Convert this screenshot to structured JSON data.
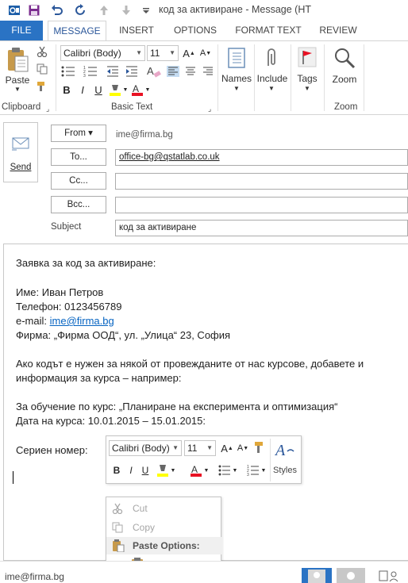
{
  "window": {
    "title": "код за активиране - Message (HT"
  },
  "quick_access": [
    "outlook-icon",
    "save-icon",
    "undo-icon",
    "redo-icon",
    "up-arrow-icon",
    "down-arrow-icon",
    "more-icon"
  ],
  "tabs": [
    {
      "label": "FILE"
    },
    {
      "label": "MESSAGE"
    },
    {
      "label": "INSERT"
    },
    {
      "label": "OPTIONS"
    },
    {
      "label": "FORMAT TEXT"
    },
    {
      "label": "REVIEW"
    }
  ],
  "ribbon": {
    "paste_label": "Paste",
    "clipboard_label": "Clipboard",
    "font_name": "Calibri (Body)",
    "font_size": "11",
    "basic_text_label": "Basic Text",
    "bold": "B",
    "italic": "I",
    "underline": "U",
    "names_label": "Names",
    "include_label": "Include",
    "tags_label": "Tags",
    "zoom_label": "Zoom",
    "zoom_group_label": "Zoom",
    "highlight_color": "#ffff00",
    "font_color": "#e81123"
  },
  "header": {
    "send_label": "Send",
    "from_label": "From ▾",
    "from_value": "ime@firma.bg",
    "to_label": "To...",
    "to_value": "office-bg@qstatlab.co.uk",
    "cc_label": "Cc...",
    "bcc_label": "Bcc...",
    "subject_label": "Subject",
    "subject_value": "код за активиране"
  },
  "body": {
    "line1": "Заявка за код за активиране:",
    "line2": "Име: Иван Петров",
    "line3": "Телефон: 0123456789",
    "line4_prefix": "e-mail: ",
    "line4_link": "ime@firma.bg",
    "line5": "Фирма: „Фирма ООД“, ул. „Улица“ 23, София",
    "line6": "Ако кодът е нужен за някой от провежданите от нас курсове, добавете и",
    "line7": "информация за курса – например:",
    "line8": "За обучение по курс: „Планиране на експеримента и оптимизация“",
    "line9": "Дата на курса: 10.01.2015 – 15.01.2015:",
    "line10": "Сериен номер:"
  },
  "mini_toolbar": {
    "font_name": "Calibri (Body)",
    "font_size": "11",
    "bold": "B",
    "italic": "I",
    "underline": "U",
    "styles_label": "Styles"
  },
  "context_menu": {
    "cut": "Cut",
    "copy": "Copy",
    "paste_options": "Paste Options:"
  },
  "status": {
    "sender": "ime@firma.bg"
  }
}
